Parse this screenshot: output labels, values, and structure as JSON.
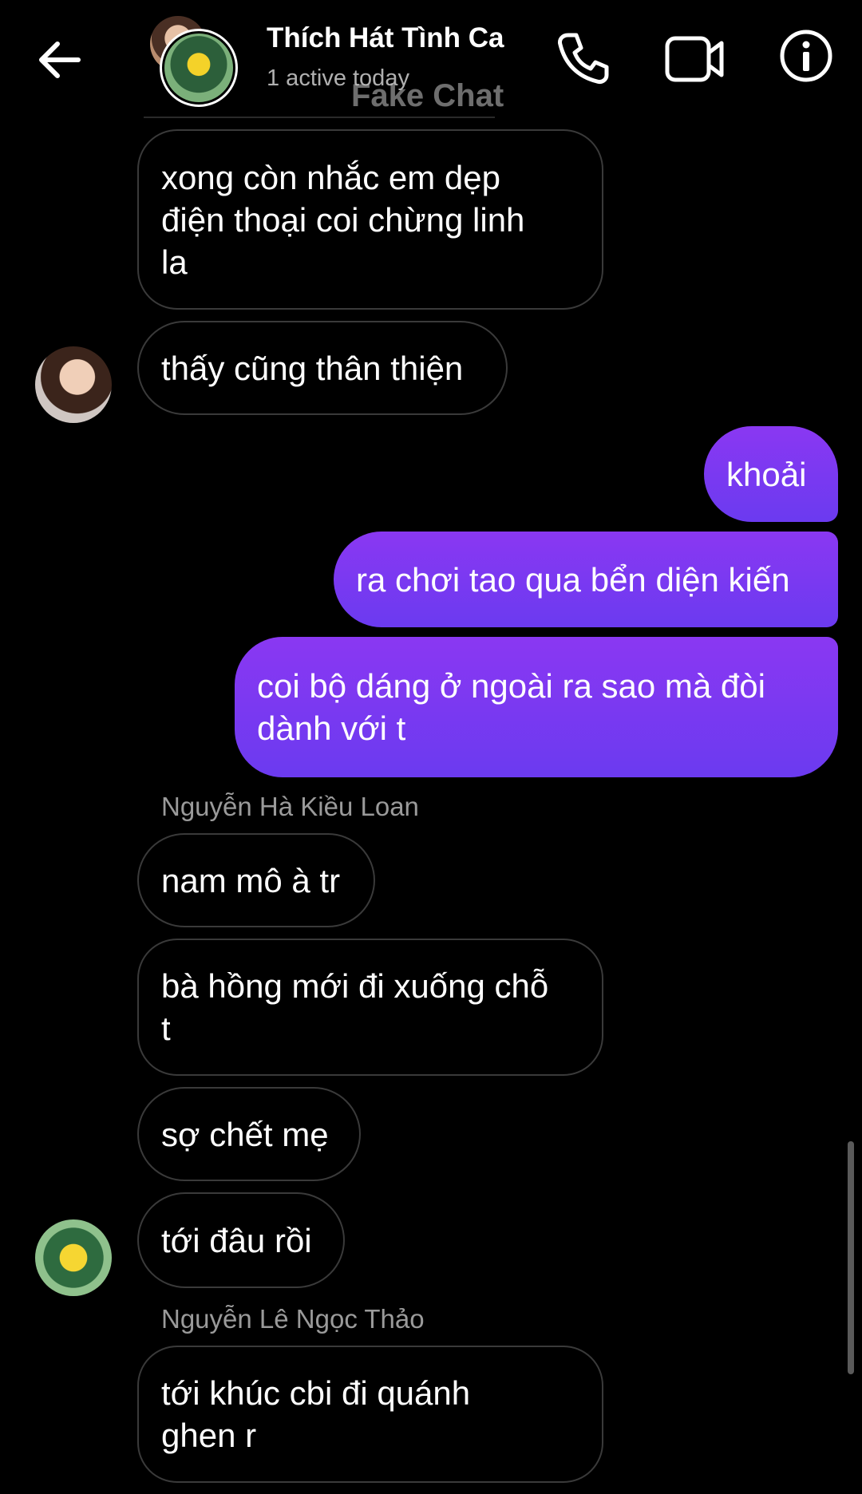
{
  "header": {
    "title": "Thích Hát Tình Ca",
    "status": "1 active today",
    "watermark": "Fake Chat",
    "icons": {
      "back": "back-arrow-icon",
      "call": "phone-icon",
      "video": "video-camera-icon",
      "info": "info-icon"
    }
  },
  "messages": [
    {
      "dir": "in",
      "lines": [
        "xong còn nhắc em dẹp",
        "điện thoại coi chừng linh",
        "la"
      ]
    },
    {
      "dir": "in",
      "lines": [
        "thấy cũng thân thiện"
      ]
    },
    {
      "dir": "out",
      "lines": [
        "khoải"
      ]
    },
    {
      "dir": "out",
      "lines": [
        "ra chơi tao qua bển diện kiến"
      ]
    },
    {
      "dir": "out",
      "lines": [
        "coi bộ dáng ở ngoài ra sao mà đòi",
        "dành với t"
      ]
    },
    {
      "dir": "in",
      "lines": [
        "nam mô à tr"
      ]
    },
    {
      "dir": "in",
      "lines": [
        "bà hồng mới đi xuống chỗ",
        "t"
      ]
    },
    {
      "dir": "in",
      "lines": [
        "sợ chết mẹ"
      ]
    },
    {
      "dir": "in",
      "lines": [
        "tới đâu rồi"
      ]
    },
    {
      "dir": "in",
      "lines": [
        "tới khúc cbi đi quánh",
        "ghen r"
      ]
    }
  ],
  "senders": [
    "Nguyễn Hà Kiều Loan",
    "Nguyễn Lê Ngọc Thảo"
  ],
  "colors": {
    "background": "#000000",
    "outgoing_bubble_top": "#8a38f2",
    "outgoing_bubble_bottom": "#6b3af0",
    "incoming_border": "#3a3a3a",
    "secondary_text": "#9a9a9a"
  }
}
